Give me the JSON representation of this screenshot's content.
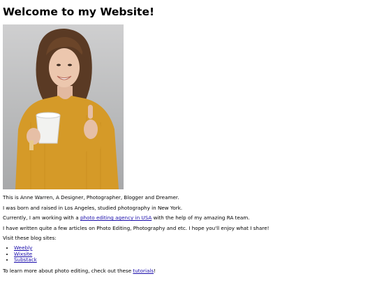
{
  "heading": "Welcome to my Website!",
  "image": {
    "alt": "Smiling woman in a mustard sweater holding a white mug and giving a thumbs up"
  },
  "intro": "This is Anne Warren, A Designer, Photographer, Blogger and Dreamer.",
  "background": "I was born and raised in Los Angeles, studied photography in New York.",
  "work": {
    "before": "Currently, I am working with a ",
    "link": "photo editing agency in USA",
    "after": " with the help of my amazing RA team."
  },
  "articles": "I have written quite a few articles on Photo Editing, Photography and etc. I hope you'll enjoy what I share!",
  "blogs": {
    "label": "Visit these blog sites:",
    "items": [
      "Weebly",
      "Wixsite",
      "Substack"
    ]
  },
  "learn_more": {
    "before": "To learn more about photo editing, check out these ",
    "link": "tutorials",
    "after": "!"
  }
}
